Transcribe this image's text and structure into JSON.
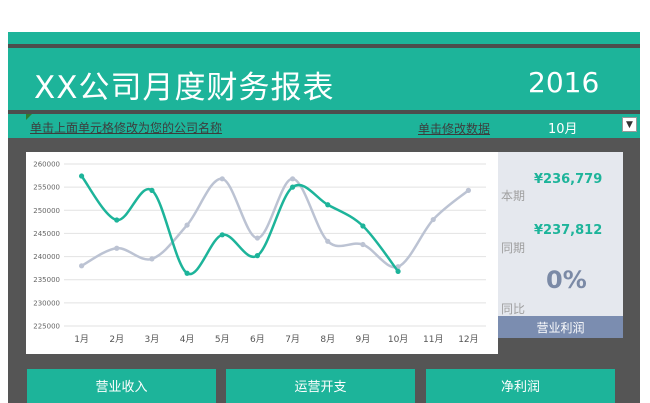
{
  "header": {
    "title": "XX公司月度财务报表",
    "year": "2016"
  },
  "controls": {
    "hint_link": "单击上面单元格修改为您的公司名称",
    "edit_link": "单击修改数据",
    "month_value": "10月"
  },
  "summary": {
    "current_label": "本期",
    "current_value": "¥236,779",
    "prior_label": "同期",
    "prior_value": "¥237,812",
    "ratio_label": "同比",
    "ratio_value": "0%",
    "metric_button": "营业利润"
  },
  "cards": [
    "营业收入",
    "运营开支",
    "净利润"
  ],
  "colors": {
    "accent": "#1db49a",
    "series_gray": "#bcc3d3",
    "series_teal": "#1db49a",
    "panel": "#555555",
    "button": "#7b8db0"
  },
  "chart_data": {
    "type": "line",
    "categories": [
      "1月",
      "2月",
      "3月",
      "4月",
      "5月",
      "6月",
      "7月",
      "8月",
      "9月",
      "10月",
      "11月",
      "12月"
    ],
    "y_ticks": [
      "260000",
      "255000",
      "250000",
      "245000",
      "240000",
      "235000",
      "230000",
      "225000"
    ],
    "ylim": [
      225000,
      260000
    ],
    "series": [
      {
        "color": "#bcc3d3",
        "values": [
          238000,
          241800,
          239500,
          246800,
          256800,
          244000,
          256800,
          243300,
          242600,
          237800,
          248000,
          254300
        ]
      },
      {
        "color": "#1db49a",
        "values": [
          257400,
          247900,
          254300,
          236400,
          244700,
          240200,
          255000,
          251200,
          246600,
          236800
        ]
      }
    ],
    "grid": true,
    "legend": "none"
  }
}
